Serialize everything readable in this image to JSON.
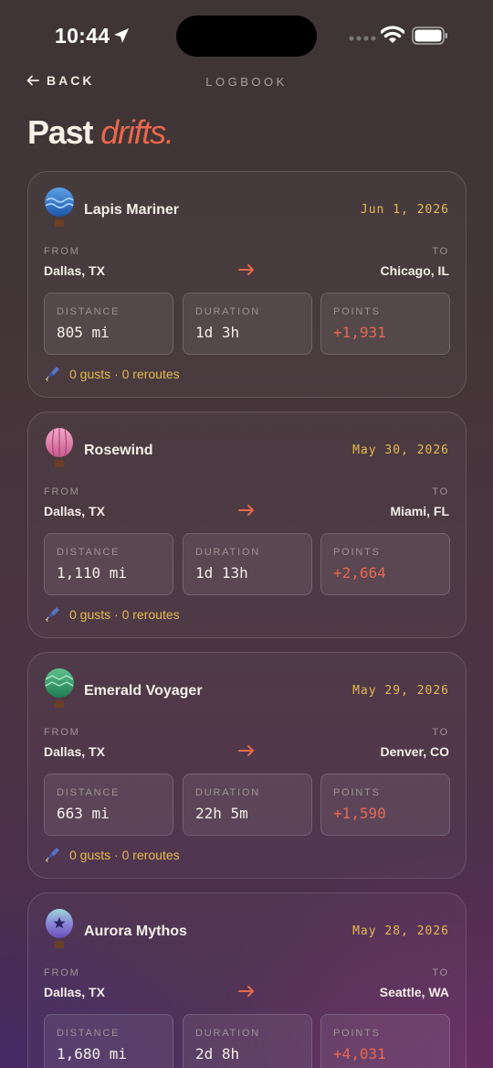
{
  "status_bar": {
    "time": "10:44"
  },
  "nav": {
    "back_label": "BACK",
    "title": "LOGBOOK"
  },
  "page_title": {
    "main": "Past",
    "accent": "drifts."
  },
  "labels": {
    "from": "FROM",
    "to": "TO",
    "distance": "DISTANCE",
    "duration": "DURATION",
    "points": "POINTS"
  },
  "colors": {
    "accent": "#e8684e",
    "gold": "#e6b94f",
    "text": "#f3eee6",
    "muted": "#9d9393"
  },
  "trips": [
    {
      "balloon": "lapis-balloon-icon",
      "name": "Lapis Mariner",
      "date": "Jun 1, 2026",
      "from": "Dallas, TX",
      "to": "Chicago, IL",
      "distance": "805 mi",
      "duration": "1d 3h",
      "points": "+1,931",
      "summary": "0 gusts · 0 reroutes"
    },
    {
      "balloon": "rose-balloon-icon",
      "name": "Rosewind",
      "date": "May 30, 2026",
      "from": "Dallas, TX",
      "to": "Miami, FL",
      "distance": "1,110 mi",
      "duration": "1d 13h",
      "points": "+2,664",
      "summary": "0 gusts · 0 reroutes"
    },
    {
      "balloon": "emerald-balloon-icon",
      "name": "Emerald Voyager",
      "date": "May 29, 2026",
      "from": "Dallas, TX",
      "to": "Denver, CO",
      "distance": "663 mi",
      "duration": "22h 5m",
      "points": "+1,590",
      "summary": "0 gusts · 0 reroutes"
    },
    {
      "balloon": "aurora-balloon-icon",
      "name": "Aurora Mythos",
      "date": "May 28, 2026",
      "from": "Dallas, TX",
      "to": "Seattle, WA",
      "distance": "1,680 mi",
      "duration": "2d 8h",
      "points": "+4,031",
      "summary": ""
    }
  ]
}
